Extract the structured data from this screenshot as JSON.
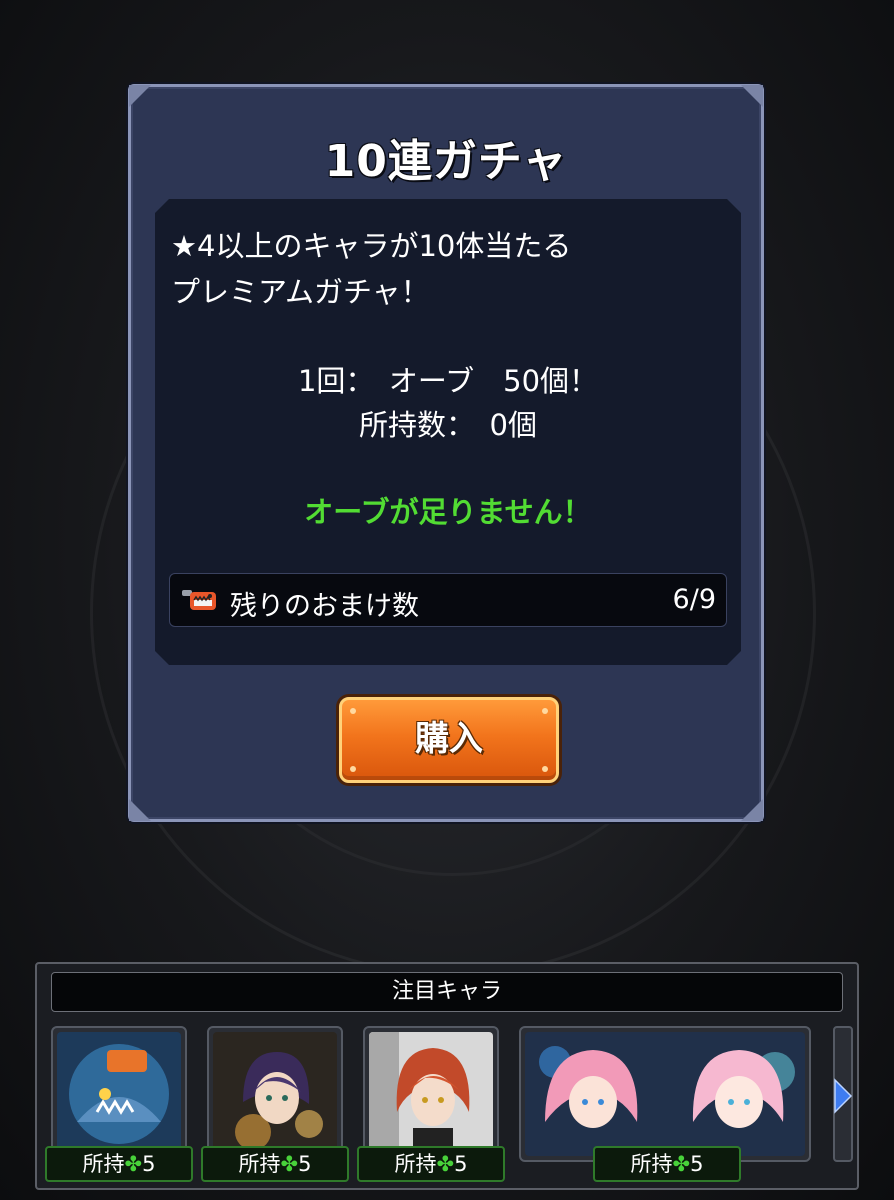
{
  "dialog": {
    "title": "10連ガチャ",
    "description_line1": "★4以上のキャラが10体当たる",
    "description_line2": "プレミアムガチャ！",
    "cost_line": "1回：　オーブ　50個！",
    "owned_line": "所持数：　0個",
    "warning": "オーブが足りません！",
    "bonus": {
      "icon": "chainsaw-icon",
      "label": "残りのおまけ数",
      "count": "6/9"
    },
    "buy_button_label": "購入"
  },
  "featured": {
    "header": "注目キャラ",
    "characters": [
      {
        "name": "shark-chainsaw-character",
        "owned_label": "所持",
        "owned_count": "5"
      },
      {
        "name": "reze-character",
        "owned_label": "所持",
        "owned_count": "5"
      },
      {
        "name": "makima-character",
        "owned_label": "所持",
        "owned_count": "5"
      },
      {
        "name": "pink-hair-character-pair",
        "owned_label": "所持",
        "owned_count": "5"
      }
    ],
    "clover_symbol": "✤"
  },
  "colors": {
    "dialog_bg": "#2d3654",
    "content_bg": "#141a2b",
    "warning_green": "#52dc33",
    "button_orange": "#f2741c",
    "badge_green": "#48d23a"
  }
}
